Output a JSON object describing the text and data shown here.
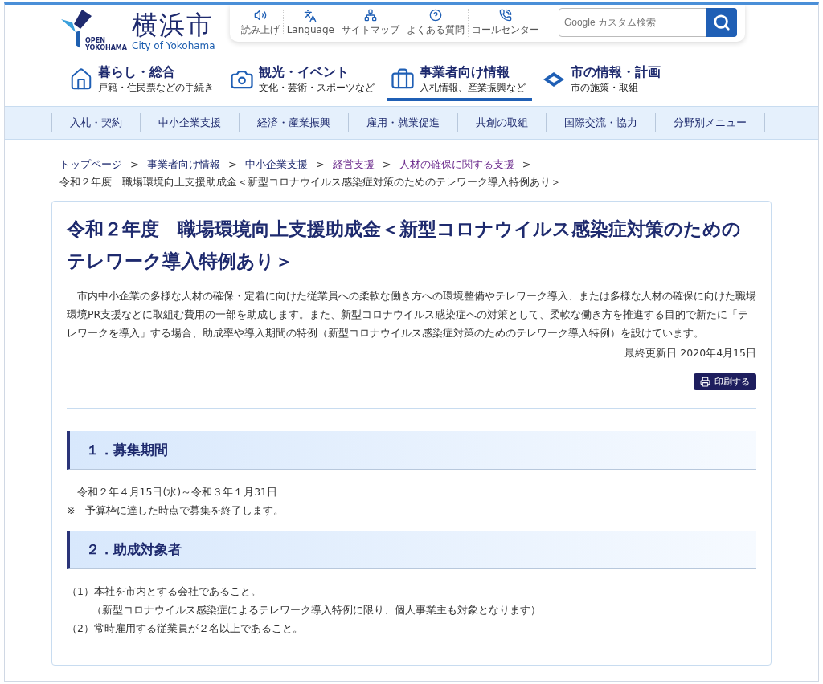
{
  "logo": {
    "tag": "OPEN YOKOHAMA",
    "name": "横浜市",
    "subname": "City of Yokohama"
  },
  "utility_links": [
    {
      "kind": "speaker",
      "label": "読み上げ"
    },
    {
      "kind": "language",
      "label": "Language"
    },
    {
      "kind": "sitemap",
      "label": "サイトマップ"
    },
    {
      "kind": "faq",
      "label": "よくある質問"
    },
    {
      "kind": "phone",
      "label": "コールセンター"
    }
  ],
  "search": {
    "placeholder": "Google カスタム検索"
  },
  "main_nav": [
    {
      "kind": "home",
      "title": "暮らし・総合",
      "subtitle": "戸籍・住民票などの手続き",
      "selected": false
    },
    {
      "kind": "camera",
      "title": "観光・イベント",
      "subtitle": "文化・芸術・スポーツなど",
      "selected": false
    },
    {
      "kind": "business",
      "title": "事業者向け情報",
      "subtitle": "入札情報、産業振興など",
      "selected": true
    },
    {
      "kind": "city",
      "title": "市の情報・計画",
      "subtitle": "市の施策・取組",
      "selected": false
    }
  ],
  "sub_nav": [
    "入札・契約",
    "中小企業支援",
    "経済・産業振興",
    "雇用・就業促進",
    "共創の取組",
    "国際交流・協力",
    "分野別メニュー"
  ],
  "breadcrumb": {
    "separator": ">",
    "links": [
      {
        "label": "トップページ",
        "visited": false
      },
      {
        "label": "事業者向け情報",
        "visited": false
      },
      {
        "label": "中小企業支援",
        "visited": false
      },
      {
        "label": "経営支援",
        "visited": true
      },
      {
        "label": "人材の確保に関する支援",
        "visited": true
      }
    ],
    "current": "令和２年度　職場環境向上支援助成金＜新型コロナウイルス感染症対策のためのテレワーク導入特例あり＞"
  },
  "article": {
    "title": "令和２年度　職場環境向上支援助成金＜新型コロナウイルス感染症対策のためのテレワーク導入特例あり＞",
    "lead": "市内中小企業の多様な人材の確保・定着に向けた従業員への柔軟な働き方への環境整備やテレワーク導入、または多様な人材の確保に向けた職場環境PR支援などに取組む費用の一部を助成します。また、新型コロナウイルス感染症への対策として、柔軟な働き方を推進する目的で新たに「テレワークを導入」する場合、助成率や導入期間の特例（新型コロナウイルス感染症対策のためのテレワーク導入特例）を設けています。",
    "updated": "最終更新日 2020年4月15日",
    "print_button": "印刷する",
    "sections": [
      {
        "heading": "１．募集期間",
        "lines": [
          {
            "kind": "indent",
            "text": "令和２年４月15日(水)～令和３年１月31日"
          },
          {
            "kind": "plain",
            "text": "※　予算枠に達した時点で募集を終了します。"
          }
        ]
      },
      {
        "heading": "２．助成対象者",
        "lines": [
          {
            "kind": "plain",
            "text": "（1）本社を市内とする会社であること。"
          },
          {
            "kind": "deep",
            "text": "（新型コロナウイルス感染症によるテレワーク導入特例に限り、個人事業主も対象となります）"
          },
          {
            "kind": "plain",
            "text": "（2）常時雇用する従業員が２名以上であること。"
          }
        ]
      }
    ]
  }
}
